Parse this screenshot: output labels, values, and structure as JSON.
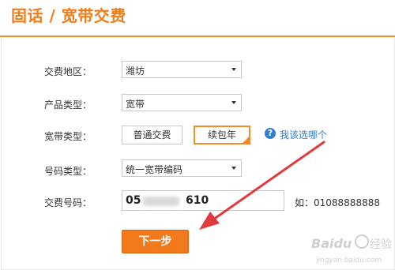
{
  "header": {
    "title": "固话 / 宽带交费"
  },
  "form": {
    "region": {
      "label": "交费地区：",
      "value": "潍坊"
    },
    "product_type": {
      "label": "产品类型：",
      "value": "宽带"
    },
    "broadband_type": {
      "label": "宽带类型：",
      "options": [
        "普通交费",
        "续包年"
      ],
      "selected": "续包年",
      "help_text": "我该选哪个"
    },
    "number_type": {
      "label": "号码类型：",
      "value": "统一宽带编码"
    },
    "payment_number": {
      "label": "交费号码：",
      "value_visible_start": "05",
      "value_visible_end": "610",
      "hint": "如：01088888888"
    },
    "next_button": "下一步"
  },
  "colors": {
    "accent": "#f07c1a",
    "help": "#2f7fd0",
    "button": "#f2791c",
    "arrow": "#e0393e"
  },
  "watermark": {
    "text": "Baidu 经验",
    "sub": "jingyan.baidu.com"
  }
}
